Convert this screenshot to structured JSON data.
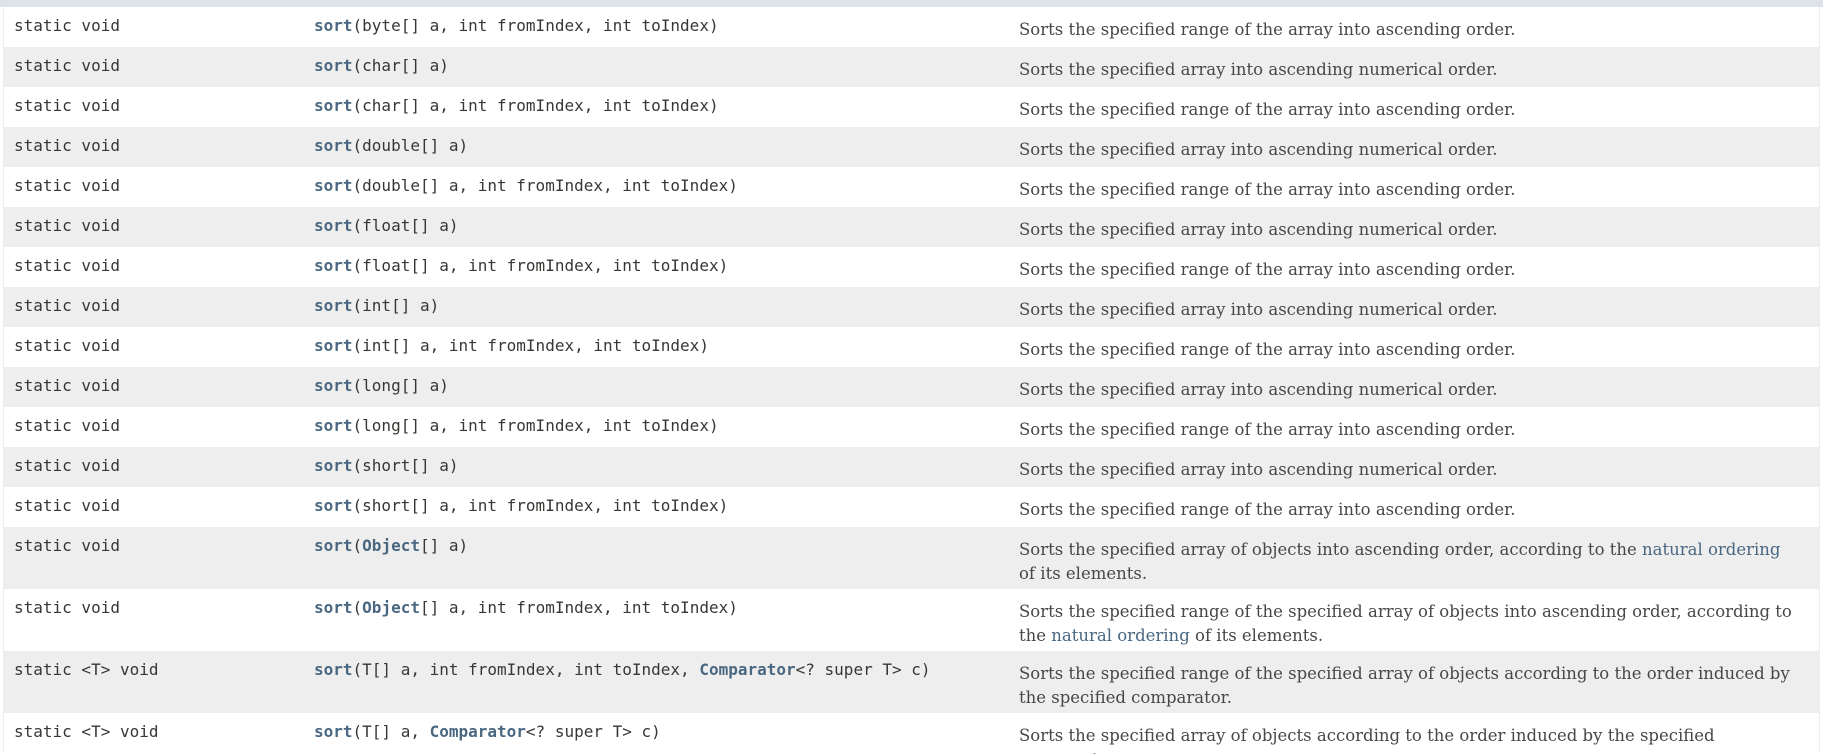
{
  "rows": [
    {
      "modifier": "static void",
      "method": "sort",
      "args": [
        {
          "text": "(byte[] a, int fromIndex, int toIndex)"
        }
      ],
      "desc": [
        {
          "text": "Sorts the specified range of the array into ascending order."
        }
      ]
    },
    {
      "modifier": "static void",
      "method": "sort",
      "args": [
        {
          "text": "(char[] a)"
        }
      ],
      "desc": [
        {
          "text": "Sorts the specified array into ascending numerical order."
        }
      ]
    },
    {
      "modifier": "static void",
      "method": "sort",
      "args": [
        {
          "text": "(char[] a, int fromIndex, int toIndex)"
        }
      ],
      "desc": [
        {
          "text": "Sorts the specified range of the array into ascending order."
        }
      ]
    },
    {
      "modifier": "static void",
      "method": "sort",
      "args": [
        {
          "text": "(double[] a)"
        }
      ],
      "desc": [
        {
          "text": "Sorts the specified array into ascending numerical order."
        }
      ]
    },
    {
      "modifier": "static void",
      "method": "sort",
      "args": [
        {
          "text": "(double[] a, int fromIndex, int toIndex)"
        }
      ],
      "desc": [
        {
          "text": "Sorts the specified range of the array into ascending order."
        }
      ]
    },
    {
      "modifier": "static void",
      "method": "sort",
      "args": [
        {
          "text": "(float[] a)"
        }
      ],
      "desc": [
        {
          "text": "Sorts the specified array into ascending numerical order."
        }
      ]
    },
    {
      "modifier": "static void",
      "method": "sort",
      "args": [
        {
          "text": "(float[] a, int fromIndex, int toIndex)"
        }
      ],
      "desc": [
        {
          "text": "Sorts the specified range of the array into ascending order."
        }
      ]
    },
    {
      "modifier": "static void",
      "method": "sort",
      "args": [
        {
          "text": "(int[] a)"
        }
      ],
      "desc": [
        {
          "text": "Sorts the specified array into ascending numerical order."
        }
      ]
    },
    {
      "modifier": "static void",
      "method": "sort",
      "args": [
        {
          "text": "(int[] a, int fromIndex, int toIndex)"
        }
      ],
      "desc": [
        {
          "text": "Sorts the specified range of the array into ascending order."
        }
      ]
    },
    {
      "modifier": "static void",
      "method": "sort",
      "args": [
        {
          "text": "(long[] a)"
        }
      ],
      "desc": [
        {
          "text": "Sorts the specified array into ascending numerical order."
        }
      ]
    },
    {
      "modifier": "static void",
      "method": "sort",
      "args": [
        {
          "text": "(long[] a, int fromIndex, int toIndex)"
        }
      ],
      "desc": [
        {
          "text": "Sorts the specified range of the array into ascending order."
        }
      ]
    },
    {
      "modifier": "static void",
      "method": "sort",
      "args": [
        {
          "text": "(short[] a)"
        }
      ],
      "desc": [
        {
          "text": "Sorts the specified array into ascending numerical order."
        }
      ]
    },
    {
      "modifier": "static void",
      "method": "sort",
      "args": [
        {
          "text": "(short[] a, int fromIndex, int toIndex)"
        }
      ],
      "desc": [
        {
          "text": "Sorts the specified range of the array into ascending order."
        }
      ]
    },
    {
      "modifier": "static void",
      "method": "sort",
      "args": [
        {
          "text": "("
        },
        {
          "text": "Object",
          "link": true
        },
        {
          "text": "[] a)"
        }
      ],
      "desc": [
        {
          "text": "Sorts the specified array of objects into ascending order, according to the "
        },
        {
          "text": "natural ordering",
          "link": true
        },
        {
          "text": " of its elements."
        }
      ]
    },
    {
      "modifier": "static void",
      "method": "sort",
      "args": [
        {
          "text": "("
        },
        {
          "text": "Object",
          "link": true
        },
        {
          "text": "[] a, int fromIndex, int toIndex)"
        }
      ],
      "desc": [
        {
          "text": "Sorts the specified range of the specified array of objects into ascending order, according to the "
        },
        {
          "text": "natural ordering",
          "link": true
        },
        {
          "text": " of its elements."
        }
      ]
    },
    {
      "modifier": "static <T> void",
      "method": "sort",
      "args": [
        {
          "text": "(T[] a, int fromIndex, int toIndex, "
        },
        {
          "text": "Comparator",
          "link": true
        },
        {
          "text": "<? super T> c)"
        }
      ],
      "desc": [
        {
          "text": "Sorts the specified range of the specified array of objects according to the order induced by the specified comparator."
        }
      ]
    },
    {
      "modifier": "static <T> void",
      "method": "sort",
      "args": [
        {
          "text": "(T[] a, "
        },
        {
          "text": "Comparator",
          "link": true
        },
        {
          "text": "<? super T> c)"
        }
      ],
      "desc": [
        {
          "text": "Sorts the specified array of objects according to the order induced by the specified comparator."
        }
      ]
    }
  ],
  "colors": {
    "row_alt": "#eeeeee",
    "link": "#4a6782",
    "code_text": "#353833",
    "desc_text": "#474747",
    "header_strip": "#dee3e9"
  }
}
